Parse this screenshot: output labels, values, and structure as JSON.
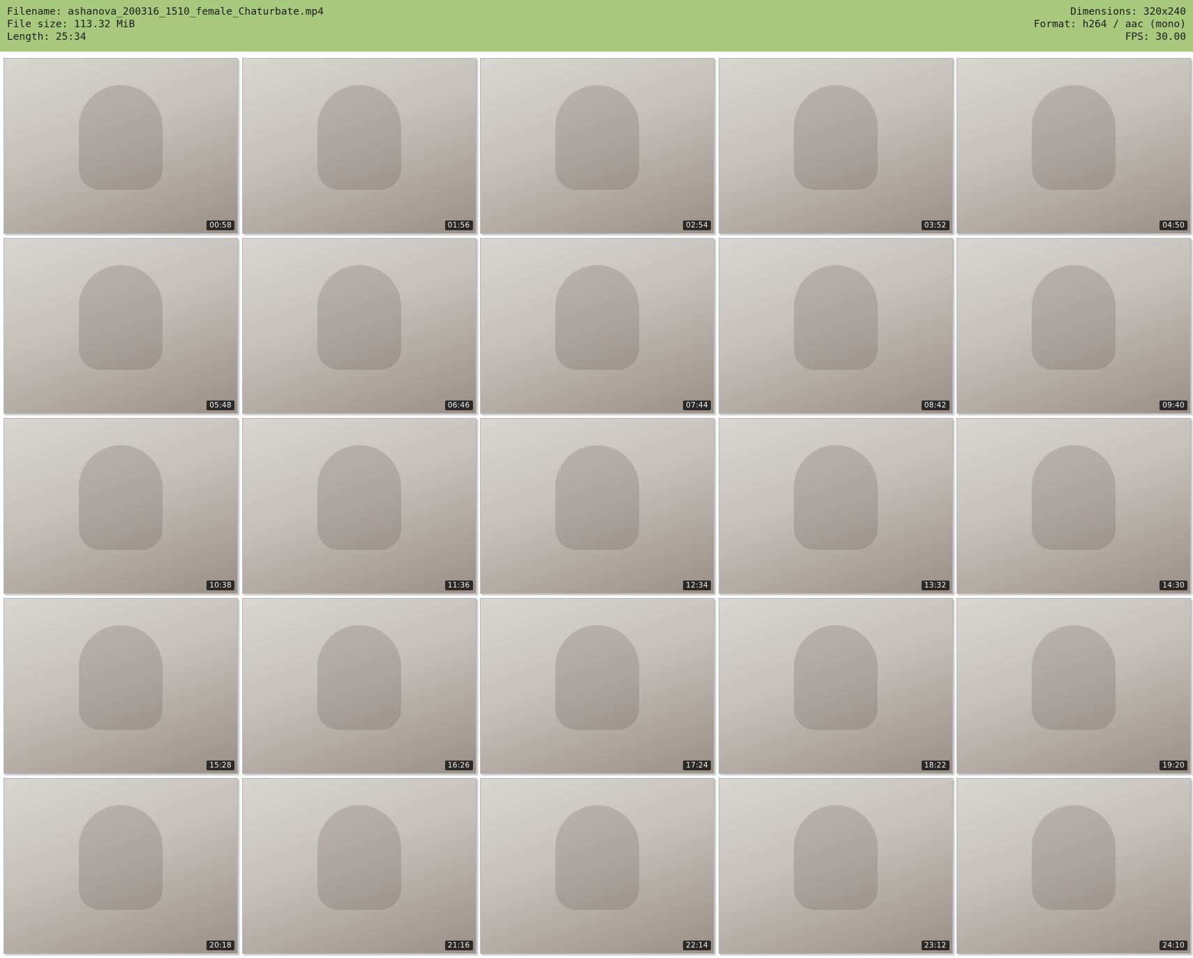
{
  "header": {
    "filename_line": "Filename: ashanova_200316_1510_female_Chaturbate.mp4",
    "filesize_line": "File size: 113.32 MiB",
    "length_line": "Length: 25:34",
    "dimensions_line": "Dimensions: 320x240",
    "format_line": "Format: h264 / aac (mono)",
    "fps_line": "FPS: 30.00"
  },
  "colors": {
    "header_background": "#a8c97d",
    "page_background": "#ffffff"
  },
  "thumbnails": [
    {
      "timestamp": "00:58"
    },
    {
      "timestamp": "01:56"
    },
    {
      "timestamp": "02:54"
    },
    {
      "timestamp": "03:52"
    },
    {
      "timestamp": "04:50"
    },
    {
      "timestamp": "05:48"
    },
    {
      "timestamp": "06:46"
    },
    {
      "timestamp": "07:44"
    },
    {
      "timestamp": "08:42"
    },
    {
      "timestamp": "09:40"
    },
    {
      "timestamp": "10:38"
    },
    {
      "timestamp": "11:36"
    },
    {
      "timestamp": "12:34"
    },
    {
      "timestamp": "13:32"
    },
    {
      "timestamp": "14:30"
    },
    {
      "timestamp": "15:28"
    },
    {
      "timestamp": "16:26"
    },
    {
      "timestamp": "17:24"
    },
    {
      "timestamp": "18:22"
    },
    {
      "timestamp": "19:20"
    },
    {
      "timestamp": "20:18"
    },
    {
      "timestamp": "21:16"
    },
    {
      "timestamp": "22:14"
    },
    {
      "timestamp": "23:12"
    },
    {
      "timestamp": "24:10"
    }
  ]
}
